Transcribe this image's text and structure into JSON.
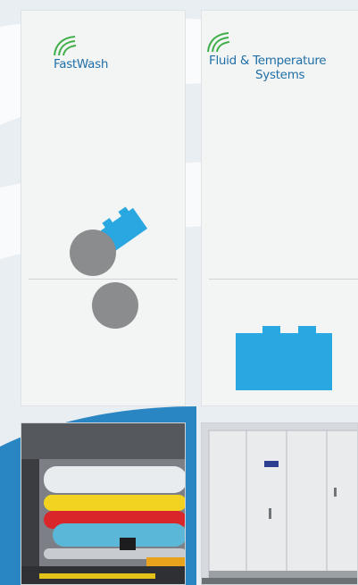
{
  "panels": [
    {
      "brand": {
        "line1": "FastWash",
        "line2": ""
      },
      "logo_icon": "wave-swoosh-icon",
      "photo": "printing-press-rollers"
    },
    {
      "brand": {
        "line1": "Fluid & Temperature",
        "line2": "Systems"
      },
      "logo_icon": "wave-swoosh-icon",
      "photo": "industrial-cabinet"
    }
  ],
  "colors": {
    "brand_blue": "#1f6fa8",
    "cyan_block": "#29a7e0",
    "gray_disc": "#8a8c8e",
    "panel_bg": "#f3f4f4",
    "accent_blue": "#2a86c2"
  }
}
